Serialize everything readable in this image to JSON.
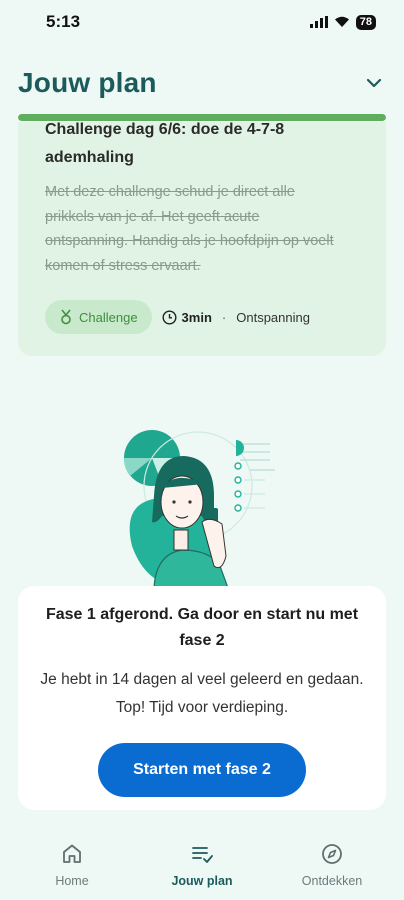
{
  "status_bar": {
    "time": "5:13",
    "battery": "78"
  },
  "header": {
    "title": "Jouw plan",
    "progress_fraction": 1.0
  },
  "challenge_card": {
    "title": "Challenge dag 6/6: doe de 4-7-8 ademhaling",
    "description": "Met deze challenge schud je direct alle prikkels van je af. Het geeft acute ontspanning. Handig als je hoofdpijn op voelt komen of stress ervaart.",
    "tag_label": "Challenge",
    "duration": "3min",
    "separator": "·",
    "category": "Ontspanning"
  },
  "phase_card": {
    "title": "Fase 1 afgerond. Ga door en start nu met fase 2",
    "body": "Je hebt in 14 dagen al veel geleerd en gedaan. Top! Tijd voor verdieping.",
    "cta_label": "Starten met fase 2"
  },
  "bottom_nav": {
    "items": [
      {
        "label": "Home",
        "icon": "home-icon",
        "active": false
      },
      {
        "label": "Jouw plan",
        "icon": "plan-list-icon",
        "active": true
      },
      {
        "label": "Ontdekken",
        "icon": "compass-icon",
        "active": false
      }
    ]
  },
  "colors": {
    "background": "#eef8f5",
    "title_teal": "#1c5b5c",
    "progress_green": "#5fae5f",
    "card_green": "#e1f3e4",
    "cta_blue": "#0a6bd1",
    "illustration_teal": "#23b39a"
  }
}
